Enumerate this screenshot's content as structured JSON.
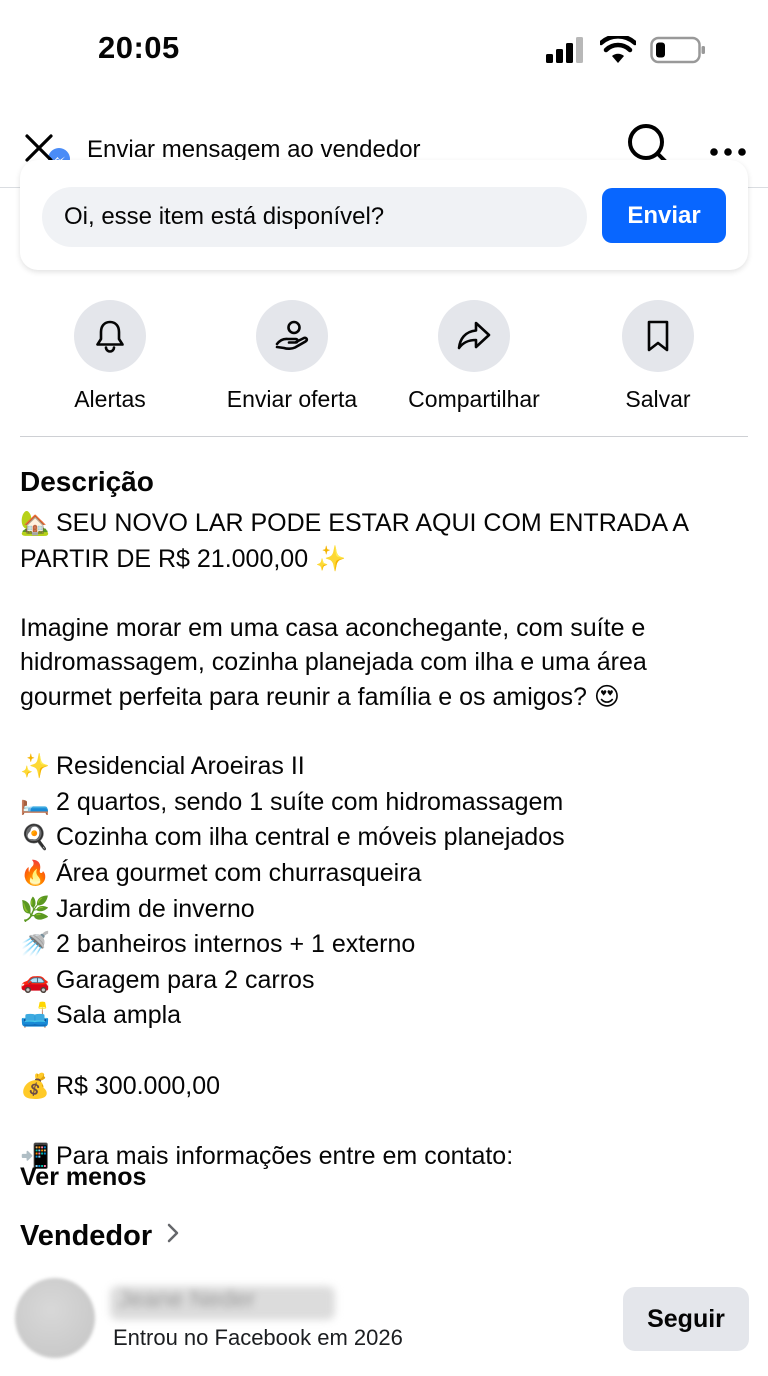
{
  "status_bar": {
    "time": "20:05",
    "icons": [
      "cellular-signal-icon",
      "wifi-icon",
      "battery-icon"
    ]
  },
  "header": {
    "title": "Enviar mensagem ao vendedor",
    "close_icon": "close-icon",
    "messenger_icon": "messenger-icon",
    "search_icon": "search-icon",
    "more_icon": "more-icon"
  },
  "message": {
    "input_value": "Oi, esse item está disponível?",
    "send_label": "Enviar"
  },
  "actions": [
    {
      "label": "Alertas",
      "icon": "bell-icon"
    },
    {
      "label": "Enviar oferta",
      "icon": "offer-icon"
    },
    {
      "label": "Compartilhar",
      "icon": "share-icon"
    },
    {
      "label": "Salvar",
      "icon": "bookmark-icon"
    }
  ],
  "description": {
    "title": "Descrição",
    "headline_line1": "SEU NOVO LAR PODE ESTAR AQUI COM ENTRADA A",
    "headline_line2": "PARTIR DE R$ 21.000,00",
    "intro_line1": "Imagine morar em uma casa aconchegante, com suíte e",
    "intro_line2": "hidromassagem, cozinha planejada com ilha e uma área",
    "intro_line3": "gourmet perfeita para reunir a família e os amigos?",
    "features": [
      {
        "emoji": "✨",
        "text": "Residencial Aroeiras II"
      },
      {
        "emoji": "🛏️",
        "text": "2 quartos, sendo 1 suíte com hidromassagem"
      },
      {
        "emoji": "🍳",
        "text": "Cozinha com ilha central e móveis planejados"
      },
      {
        "emoji": "🔥",
        "text": "Área gourmet com churrasqueira"
      },
      {
        "emoji": "🌿",
        "text": "Jardim de inverno"
      },
      {
        "emoji": "🚿",
        "text": "2 banheiros internos + 1 externo"
      },
      {
        "emoji": "🚗",
        "text": "Garagem para 2 carros"
      },
      {
        "emoji": "🛋️",
        "text": "Sala ampla"
      }
    ],
    "price_emoji": "💰",
    "price": "R$ 300.000,00",
    "contact_emoji": "📲",
    "contact": "Para mais informações entre em contato:",
    "headline_emoji": "🏡",
    "headline_end_emoji": "✨",
    "intro_end_emoji": "😍",
    "see_less": "Ver menos"
  },
  "seller": {
    "section_title": "Vendedor",
    "name_blurred": "Jeane Neder",
    "joined": "Entrou no Facebook em 2026",
    "follow_label": "Seguir"
  }
}
